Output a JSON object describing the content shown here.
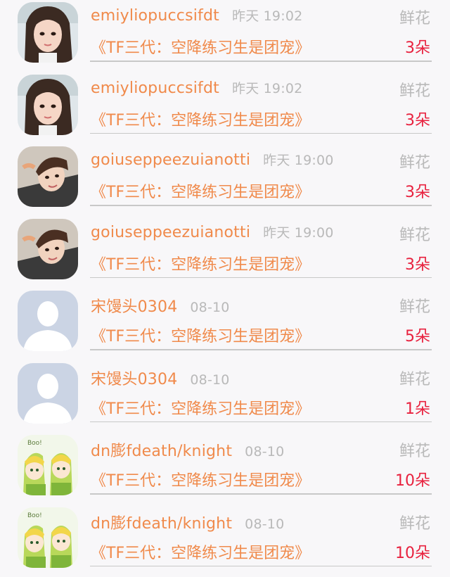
{
  "list": {
    "items": [
      {
        "name": "emiyliopuccsifdt",
        "time": "昨天 19:02",
        "label": "鲜花",
        "book": "《TF三代：空降练习生是团宠》",
        "count": "3朵",
        "avatar": "girl-avatar"
      },
      {
        "name": "emiyliopuccsifdt",
        "time": "昨天 19:02",
        "label": "鲜花",
        "book": "《TF三代：空降练习生是团宠》",
        "count": "3朵",
        "avatar": "girl-avatar"
      },
      {
        "name": "goiuseppeezuianotti",
        "time": "昨天 19:00",
        "label": "鲜花",
        "book": "《TF三代：空降练习生是团宠》",
        "count": "3朵",
        "avatar": "boy-avatar"
      },
      {
        "name": "goiuseppeezuianotti",
        "time": "昨天 19:00",
        "label": "鲜花",
        "book": "《TF三代：空降练习生是团宠》",
        "count": "3朵",
        "avatar": "boy-avatar"
      },
      {
        "name": "宋馒头0304",
        "time": "08-10",
        "label": "鲜花",
        "book": "《TF三代：空降练习生是团宠》",
        "count": "5朵",
        "avatar": "default-user-avatar"
      },
      {
        "name": "宋馒头0304",
        "time": "08-10",
        "label": "鲜花",
        "book": "《TF三代：空降练习生是团宠》",
        "count": "1朵",
        "avatar": "default-user-avatar"
      },
      {
        "name": "dn膨fdeath/knight",
        "time": "08-10",
        "label": "鲜花",
        "book": "《TF三代：空降练习生是团宠》",
        "count": "10朵",
        "avatar": "cartoon-elves-avatar"
      },
      {
        "name": "dn膨fdeath/knight",
        "time": "08-10",
        "label": "鲜花",
        "book": "《TF三代：空降练习生是团宠》",
        "count": "10朵",
        "avatar": "cartoon-elves-avatar"
      }
    ]
  },
  "colors": {
    "name": "#f08a4b",
    "muted": "#b9b9b9",
    "count": "#e8213e",
    "background": "#f8f7f9"
  }
}
